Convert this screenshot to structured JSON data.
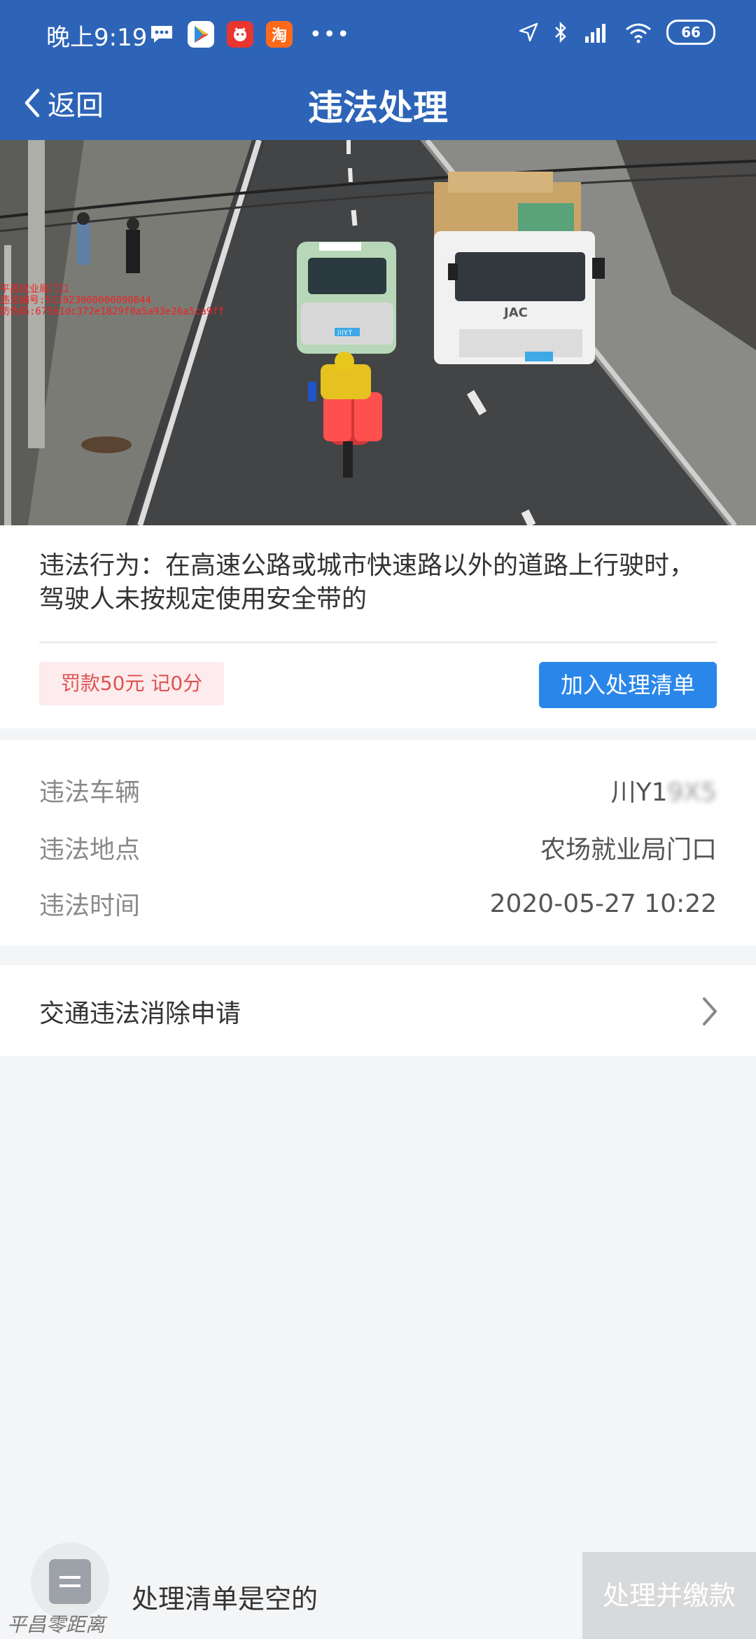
{
  "status_bar": {
    "time": "晚上9:19",
    "battery": "66",
    "app_icons": [
      "message-icon",
      "play-store-icon",
      "pinduoduo-icon",
      "taobao-icon"
    ],
    "taobao_char": "淘"
  },
  "nav": {
    "back_label": "返回",
    "title": "违法处理"
  },
  "photo": {
    "overlay_lines": [
      "平昌就业局门口",
      "违法编号:511923000000090044",
      "防伪码:67561dc372e1829f0a5a93e26a5ca9ff"
    ],
    "taxi_plate": "川Y.T",
    "truck_brand": "JAC"
  },
  "violation": {
    "description": "违法行为：在高速公路或城市快速路以外的道路上行驶时，驾驶人未按规定使用安全带的",
    "penalty": "罚款50元 记0分",
    "add_button": "加入处理清单"
  },
  "details": {
    "vehicle_label": "违法车辆",
    "vehicle_prefix": "川Y1",
    "vehicle_blurred": "9X",
    "vehicle_suffix": "5",
    "location_label": "违法地点",
    "location_value": "农场就业局门口",
    "time_label": "违法时间",
    "time_value": "2020-05-27 10:22"
  },
  "cancel_request": {
    "label": "交通违法消除申请"
  },
  "bottom": {
    "empty_text": "处理清单是空的",
    "pay_button": "处理并缴款"
  },
  "watermark": "平昌零距离",
  "colors": {
    "header": "#2d64b8",
    "primary_button": "#2a86e8",
    "penalty_text": "#e05252",
    "penalty_bg": "#fdeced",
    "disabled_button": "#d8d9db"
  }
}
